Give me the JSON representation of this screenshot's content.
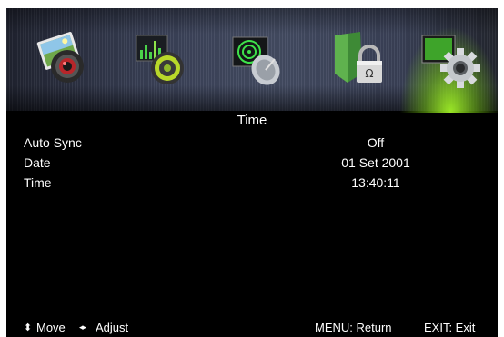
{
  "menu_icons": [
    {
      "name": "picture-icon",
      "active": false
    },
    {
      "name": "sound-icon",
      "active": false
    },
    {
      "name": "channel-icon",
      "active": false
    },
    {
      "name": "lock-icon",
      "active": false
    },
    {
      "name": "setup-icon",
      "active": true
    }
  ],
  "page": {
    "title": "Time"
  },
  "settings": [
    {
      "label": "Auto Sync",
      "value": "Off"
    },
    {
      "label": "Date",
      "value": "01 Set 2001"
    },
    {
      "label": "Time",
      "value": "13:40:11"
    }
  ],
  "footer": {
    "move_icon": "⬍",
    "move_label": "Move",
    "adjust_icon": "◂▸",
    "adjust_label": "Adjust",
    "return_label": "MENU: Return",
    "exit_label": "EXIT: Exit"
  },
  "colors": {
    "background": "#000000",
    "text": "#ffffff",
    "active_glow": "#aaff28"
  }
}
